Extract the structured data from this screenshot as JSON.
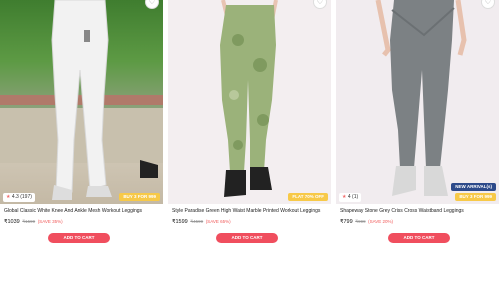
{
  "products": [
    {
      "rating": "4.3",
      "reviews": "(197)",
      "badge": "BUY 3 FOR 999",
      "title": "Global Classic White Knee And Ankle Mesh Workout Leggings",
      "price": "₹1039",
      "mrp": "₹1599",
      "save": "(SAVE 35%)",
      "cta": "ADD TO CART",
      "legging_color": "#f2f2f2"
    },
    {
      "badge": "FLAT 70% OFF",
      "title": "Style Paradise Green High Waist Marble Printed Workout Leggings",
      "price": "₹1599",
      "mrp": "₹4599",
      "save": "(SAVE 65%)",
      "cta": "ADD TO CART",
      "legging_color": "#9bb27a"
    },
    {
      "rating": "4",
      "reviews": "(1)",
      "badge_new": "NEW ARRIVAL(s)",
      "badge": "BUY 3 FOR 999",
      "title": "Shapeway Stone Grey Criss Cross Waistband Leggings",
      "price": "₹799",
      "mrp": "₹999",
      "save": "(SAVE 20%)",
      "cta": "ADD TO CART",
      "legging_color": "#7c8184"
    }
  ],
  "colors": {
    "accent": "#f04e5e",
    "badge_yellow": "#f7c948",
    "badge_new": "#2d4a8a"
  },
  "icons": {
    "wishlist": "heart-icon",
    "rating": "star-icon"
  }
}
